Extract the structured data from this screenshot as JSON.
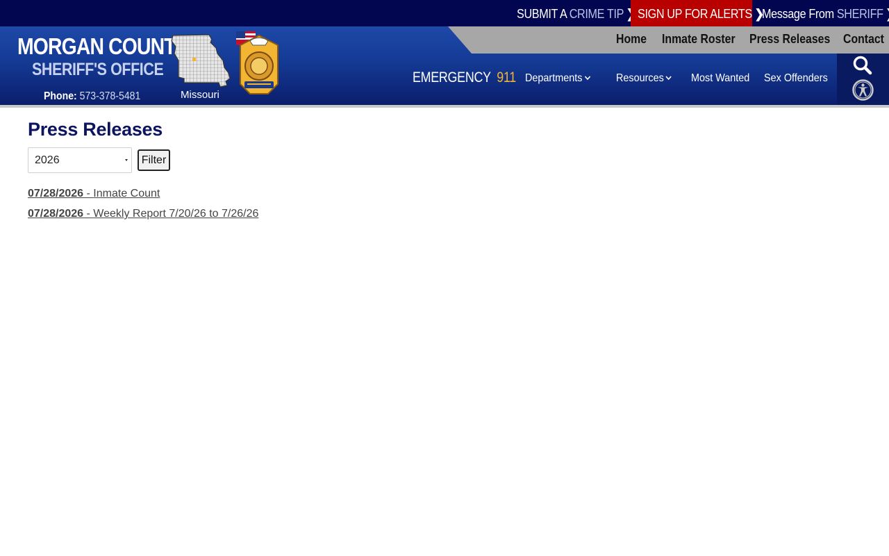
{
  "topbar": {
    "tip_prefix": "SUBMIT A",
    "tip_highlight": "CRIME TIP",
    "alerts_label": "SIGN UP FOR ALERTS",
    "sheriff_prefix": "Message From",
    "sheriff_highlight": "SHERIFF",
    "chevron": "❯",
    "alerts_bg": "#b80000",
    "bar_bg": "#020550"
  },
  "brand": {
    "title": "MORGAN COUNTY",
    "subtitle": "SHERIFF'S OFFICE",
    "phone_label": "Phone:",
    "phone_number": "573-378-5481",
    "state_label": "Missouri"
  },
  "nav_top": {
    "items": [
      "Home",
      "Inmate Roster",
      "Press Releases",
      "Contact"
    ]
  },
  "emergency": {
    "label": "EMERGENCY",
    "number": "911",
    "number_color": "#f2b632"
  },
  "nav_main": {
    "items": [
      {
        "label": "Departments",
        "icon": "chevron-down-icon"
      },
      {
        "label": "Resources",
        "icon": "chevron-down-icon"
      },
      {
        "label": "Most Wanted"
      },
      {
        "label": "Sex Offenders"
      }
    ]
  },
  "utility": {
    "search_icon": "search-icon",
    "accessibility_icon": "accessibility-icon"
  },
  "main": {
    "title": "Press Releases",
    "year_select": {
      "value": "2026"
    },
    "filter_label": "Filter",
    "releases": [
      {
        "date": "07/28/2026",
        "sep": " - ",
        "title": "Inmate Count"
      },
      {
        "date": "07/28/2026",
        "sep": " - ",
        "title": "Weekly Report 7/20/26 to 7/26/26"
      }
    ],
    "title_color": "#0d1460"
  }
}
